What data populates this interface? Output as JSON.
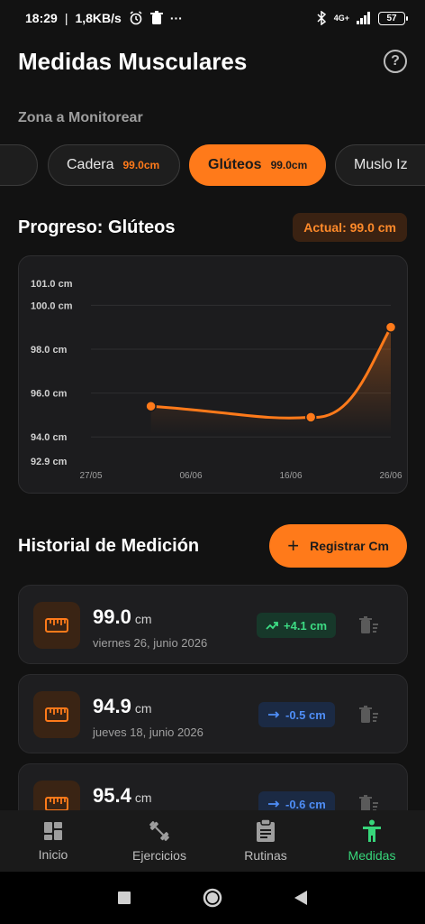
{
  "status": {
    "time": "18:29",
    "net": "1,8KB/s",
    "dots": "···",
    "network": "4G+",
    "battery": "57"
  },
  "header": {
    "title": "Medidas Musculares"
  },
  "zone": {
    "label": "Zona a Monitorear",
    "chips": [
      {
        "name": "",
        "value": "",
        "partial": true
      },
      {
        "name": "Cadera",
        "value": "99.0cm"
      },
      {
        "name": "Glúteos",
        "value": "99.0cm",
        "active": true
      },
      {
        "name": "Muslo Iz",
        "value": ""
      }
    ]
  },
  "progress": {
    "title": "Progreso: Glúteos",
    "current": "Actual: 99.0 cm"
  },
  "chart_data": {
    "type": "line",
    "x": [
      "2026-06-02",
      "2026-06-18",
      "2026-06-26"
    ],
    "values": [
      95.4,
      94.9,
      99.0
    ],
    "x_tick_labels": [
      "27/05",
      "06/06",
      "16/06",
      "26/06"
    ],
    "y_tick_labels": [
      "101.0 cm",
      "100.0 cm",
      "98.0 cm",
      "96.0 cm",
      "94.0 cm",
      "92.9 cm"
    ],
    "ylim": [
      92.9,
      101.0
    ],
    "grid": true,
    "color": "#ff7a1a"
  },
  "history": {
    "title": "Historial de Medición",
    "register_label": "Registrar Cm",
    "items": [
      {
        "value": "99.0",
        "unit": "cm",
        "date": "viernes 26, junio 2026",
        "delta": "+4.1 cm",
        "trend": "up"
      },
      {
        "value": "94.9",
        "unit": "cm",
        "date": "jueves 18, junio 2026",
        "delta": "-0.5 cm",
        "trend": "flat"
      },
      {
        "value": "95.4",
        "unit": "cm",
        "date": "",
        "delta": "-0.6 cm",
        "trend": "flat"
      }
    ]
  },
  "nav": {
    "items": [
      {
        "label": "Inicio",
        "icon": "dashboard-icon"
      },
      {
        "label": "Ejercicios",
        "icon": "dumbbell-icon"
      },
      {
        "label": "Rutinas",
        "icon": "clipboard-icon"
      },
      {
        "label": "Medidas",
        "icon": "person-icon",
        "active": true
      }
    ]
  },
  "colors": {
    "accent": "#ff7a1a",
    "active_nav": "#37d67a",
    "background": "#121212"
  }
}
